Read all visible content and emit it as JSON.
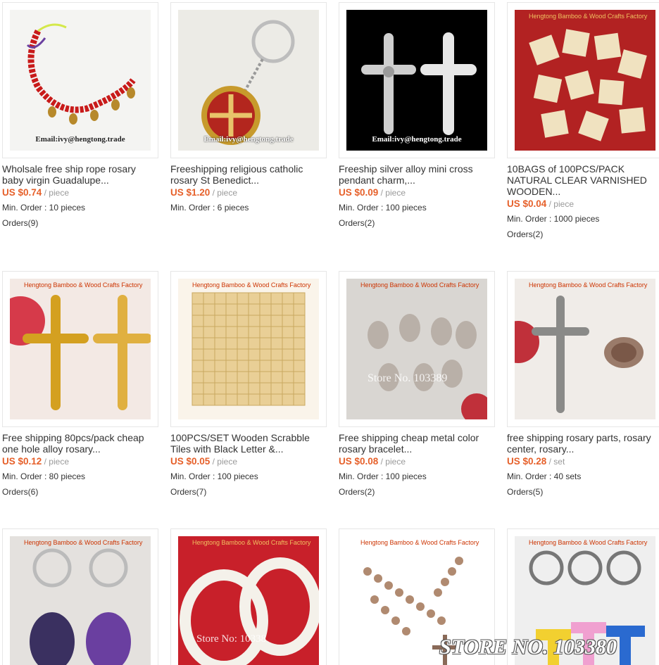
{
  "products": [
    {
      "title": "Wholsale free ship rope rosary baby virgin Guadalupe...",
      "price": "US $0.74",
      "unit": "/ piece",
      "min_order": "Min. Order : 10 pieces",
      "orders": "Orders(9)",
      "watermark": "Email:ivy@hengtong.trade"
    },
    {
      "title": "Freeshipping religious catholic rosary St Benedict...",
      "price": "US $1.20",
      "unit": "/ piece",
      "min_order": "Min. Order : 6 pieces",
      "orders": "",
      "watermark": "Email:ivy@hengtong.trade"
    },
    {
      "title": "Freeship silver alloy mini cross pendant charm,...",
      "price": "US $0.09",
      "unit": "/ piece",
      "min_order": "Min. Order : 100 pieces",
      "orders": "Orders(2)",
      "watermark": "Email:ivy@hengtong.trade"
    },
    {
      "title": "10BAGS of 100PCS/PACK NATURAL CLEAR VARNISHED WOODEN...",
      "price": "US $0.04",
      "unit": "/ piece",
      "min_order": "Min. Order : 1000 pieces",
      "orders": "Orders(2)",
      "watermark": "Hengtong Bamboo & Wood Crafts Factory"
    },
    {
      "title": "Free shipping 80pcs/pack cheap one hole alloy rosary...",
      "price": "US $0.12",
      "unit": "/ piece",
      "min_order": "Min. Order : 80 pieces",
      "orders": "Orders(6)",
      "watermark": "Hengtong Bamboo & Wood Crafts Factory"
    },
    {
      "title": "100PCS/SET Wooden Scrabble Tiles with Black Letter &...",
      "price": "US $0.05",
      "unit": "/ piece",
      "min_order": "Min. Order : 100 pieces",
      "orders": "Orders(7)",
      "watermark": "Hengtong Bamboo & Wood Crafts Factory"
    },
    {
      "title": "Free shipping cheap metal color rosary bracelet...",
      "price": "US $0.08",
      "unit": "/ piece",
      "min_order": "Min. Order : 100 pieces",
      "orders": "Orders(2)",
      "watermark": "Hengtong Bamboo & Wood Crafts Factory",
      "store": "Store No. 103389"
    },
    {
      "title": "free shipping rosary parts, rosary center, rosary...",
      "price": "US $0.28",
      "unit": "/ set",
      "min_order": "Min. Order : 40 sets",
      "orders": "Orders(5)",
      "watermark": "Hengtong Bamboo & Wood Crafts Factory"
    },
    {
      "watermark": "Hengtong Bamboo & Wood Crafts Factory"
    },
    {
      "watermark": "Hengtong Bamboo & Wood Crafts Factory",
      "store": "Store No: 10338"
    },
    {
      "watermark": "Hengtong Bamboo & Wood Crafts Factory"
    },
    {
      "watermark": "Hengtong Bamboo & Wood Crafts Factory"
    }
  ],
  "corner_store": "STORE NO. 103380"
}
